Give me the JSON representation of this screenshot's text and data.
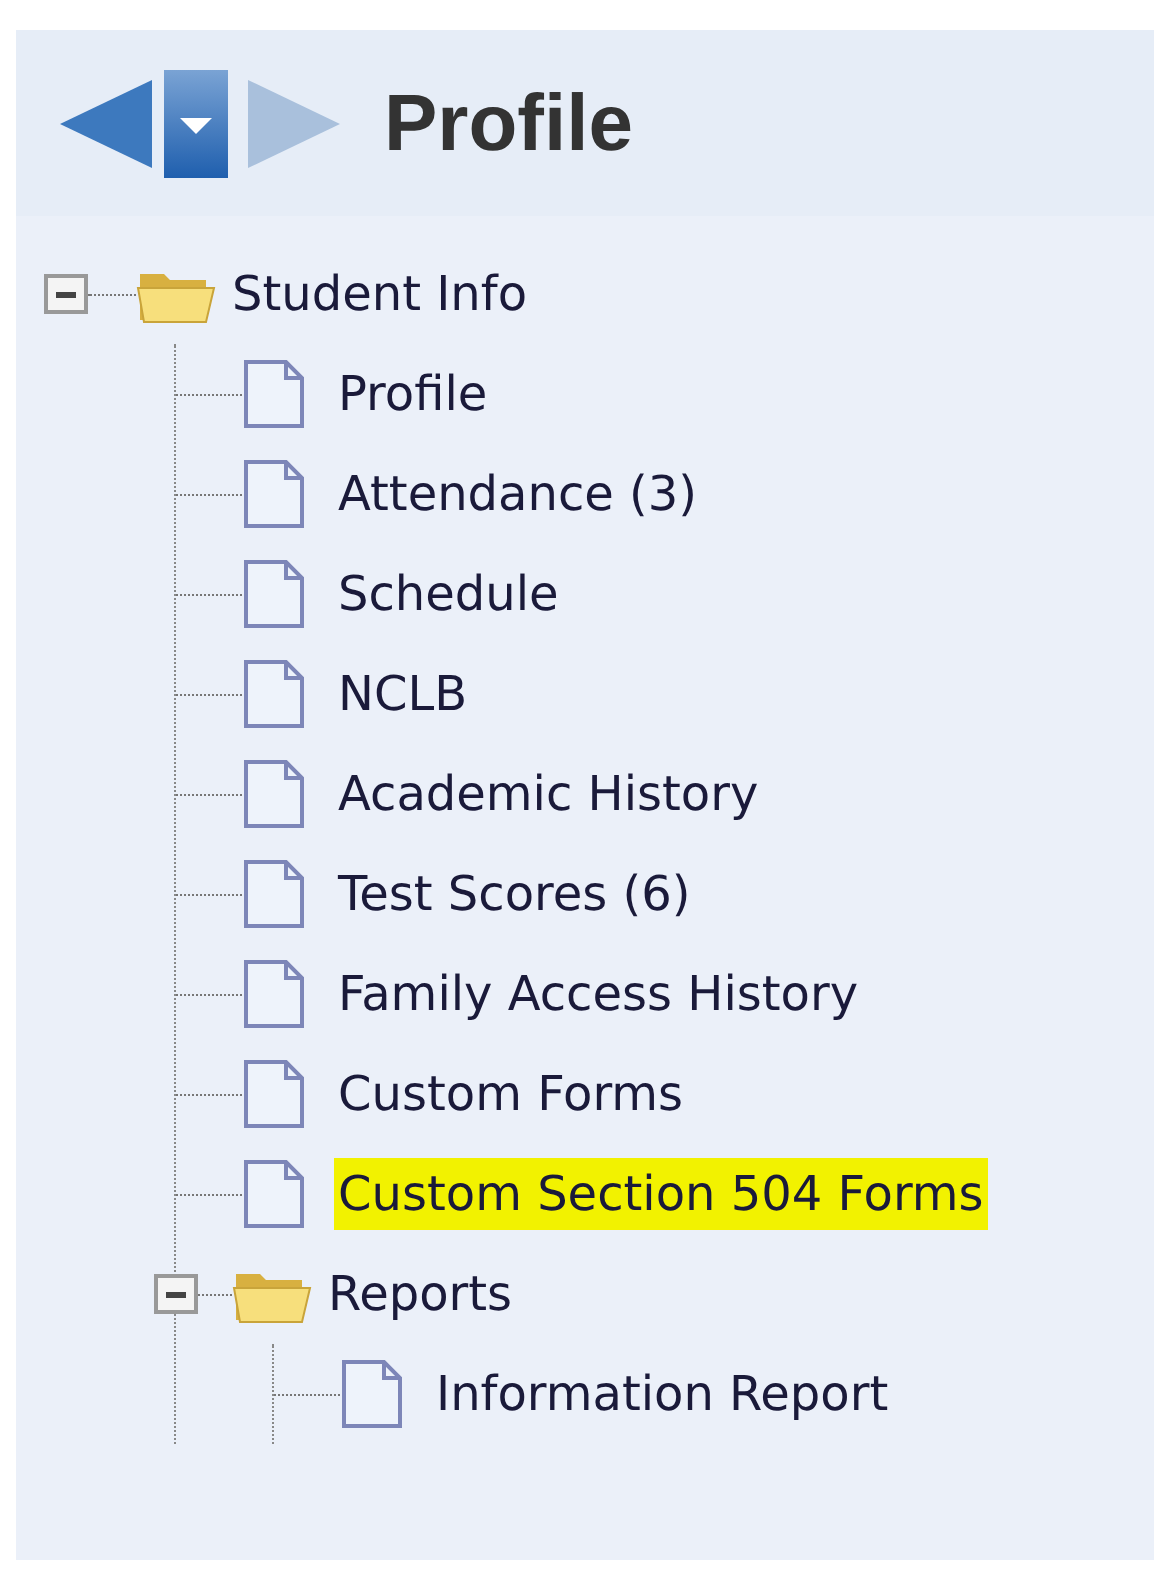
{
  "header": {
    "title": "Profile"
  },
  "tree": [
    {
      "label": "Student Info",
      "kind": "folder",
      "expanded": true,
      "highlighted": false,
      "children": [
        {
          "label": "Profile",
          "kind": "file",
          "highlighted": false
        },
        {
          "label": "Attendance (3)",
          "kind": "file",
          "highlighted": false
        },
        {
          "label": "Schedule",
          "kind": "file",
          "highlighted": false
        },
        {
          "label": "NCLB",
          "kind": "file",
          "highlighted": false
        },
        {
          "label": "Academic History",
          "kind": "file",
          "highlighted": false
        },
        {
          "label": "Test Scores (6)",
          "kind": "file",
          "highlighted": false
        },
        {
          "label": "Family Access History",
          "kind": "file",
          "highlighted": false
        },
        {
          "label": "Custom Forms",
          "kind": "file",
          "highlighted": false
        },
        {
          "label": "Custom Section 504 Forms",
          "kind": "file",
          "highlighted": true
        },
        {
          "label": "Reports",
          "kind": "folder",
          "expanded": true,
          "highlighted": false,
          "children": [
            {
              "label": "Information Report",
              "kind": "file",
              "highlighted": false
            }
          ]
        }
      ]
    }
  ]
}
